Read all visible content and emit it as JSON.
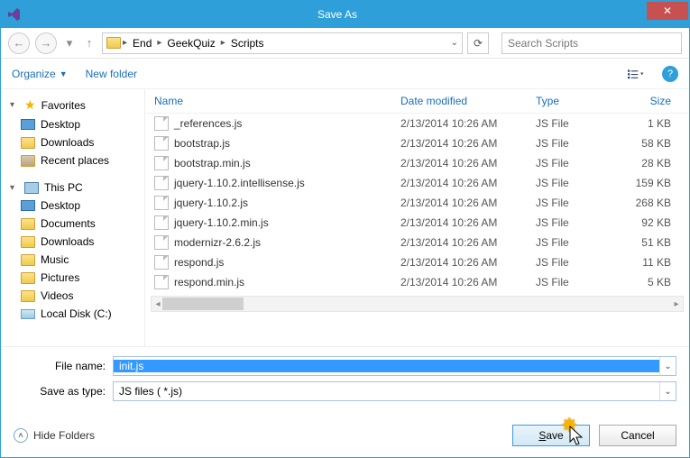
{
  "title": "Save As",
  "nav": {
    "breadcrumb": [
      "End",
      "GeekQuiz",
      "Scripts"
    ],
    "search_placeholder": "Search Scripts"
  },
  "toolbar": {
    "organize": "Organize",
    "new_folder": "New folder"
  },
  "tree": {
    "favorites": "Favorites",
    "favorites_items": [
      "Desktop",
      "Downloads",
      "Recent places"
    ],
    "this_pc": "This PC",
    "this_pc_items": [
      "Desktop",
      "Documents",
      "Downloads",
      "Music",
      "Pictures",
      "Videos",
      "Local Disk (C:)"
    ]
  },
  "columns": {
    "name": "Name",
    "date": "Date modified",
    "type": "Type",
    "size": "Size"
  },
  "files": [
    {
      "name": "_references.js",
      "date": "2/13/2014 10:26 AM",
      "type": "JS File",
      "size": "1 KB"
    },
    {
      "name": "bootstrap.js",
      "date": "2/13/2014 10:26 AM",
      "type": "JS File",
      "size": "58 KB"
    },
    {
      "name": "bootstrap.min.js",
      "date": "2/13/2014 10:26 AM",
      "type": "JS File",
      "size": "28 KB"
    },
    {
      "name": "jquery-1.10.2.intellisense.js",
      "date": "2/13/2014 10:26 AM",
      "type": "JS File",
      "size": "159 KB"
    },
    {
      "name": "jquery-1.10.2.js",
      "date": "2/13/2014 10:26 AM",
      "type": "JS File",
      "size": "268 KB"
    },
    {
      "name": "jquery-1.10.2.min.js",
      "date": "2/13/2014 10:26 AM",
      "type": "JS File",
      "size": "92 KB"
    },
    {
      "name": "modernizr-2.6.2.js",
      "date": "2/13/2014 10:26 AM",
      "type": "JS File",
      "size": "51 KB"
    },
    {
      "name": "respond.js",
      "date": "2/13/2014 10:26 AM",
      "type": "JS File",
      "size": "11 KB"
    },
    {
      "name": "respond.min.js",
      "date": "2/13/2014 10:26 AM",
      "type": "JS File",
      "size": "5 KB"
    }
  ],
  "fields": {
    "file_name_label": "File name:",
    "file_name_value": "init.js",
    "save_type_label": "Save as type:",
    "save_type_value": "JS files  ( *.js)"
  },
  "footer": {
    "hide_folders": "Hide Folders",
    "save": "Save",
    "cancel": "Cancel"
  }
}
